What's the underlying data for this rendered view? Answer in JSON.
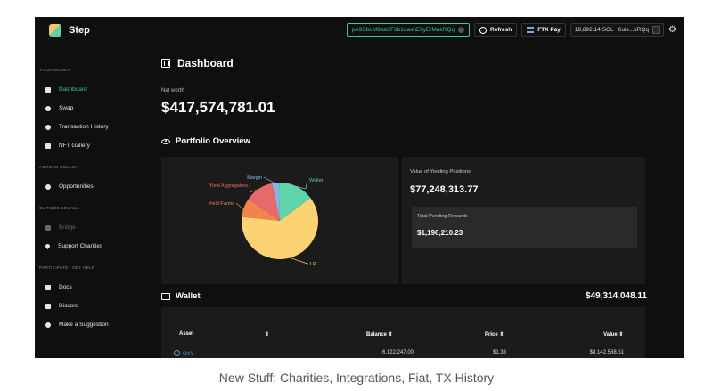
{
  "app": {
    "name": "Step"
  },
  "topbar": {
    "address": "pA9SbLM9saXFdb1dashEkyErMakRQq",
    "refresh_label": "Refresh",
    "ftx_label": "FTX Pay",
    "sol_balance": "19,892.14 SOL",
    "wallet_short": "Cuie...kRQq"
  },
  "sidebar": {
    "sections": [
      {
        "title": "YOUR MONEY",
        "items": [
          {
            "label": "Dashboard",
            "icon": "dashboard-icon",
            "active": true
          },
          {
            "label": "Swap",
            "icon": "swap-icon"
          },
          {
            "label": "Transaction History",
            "icon": "history-icon"
          },
          {
            "label": "NFT Gallery",
            "icon": "nft-icon"
          }
        ]
      },
      {
        "title": "ACROSS SOLANA",
        "items": [
          {
            "label": "Opportunities",
            "icon": "pie-icon"
          }
        ]
      },
      {
        "title": "OUTSIDE SOLANA",
        "items": [
          {
            "label": "Bridge",
            "icon": "bridge-icon",
            "disabled": true
          },
          {
            "label": "Support Charities",
            "icon": "heart-icon"
          }
        ]
      },
      {
        "title": "PARTICIPATE / GET HELP",
        "items": [
          {
            "label": "Docs",
            "icon": "docs-icon"
          },
          {
            "label": "Discord",
            "icon": "discord-icon"
          },
          {
            "label": "Make a Suggestion",
            "icon": "suggestion-icon"
          }
        ]
      }
    ]
  },
  "main": {
    "title": "Dashboard",
    "net_worth_label": "Net worth",
    "net_worth_value": "$417,574,781.01",
    "portfolio_title": "Portfolio Overview",
    "yield_label": "Value of Yielding Positions",
    "yield_value": "$77,248,313.77",
    "rewards_label": "Total Pending Rewards",
    "rewards_value": "$1,196,210.23",
    "wallet_title": "Wallet",
    "wallet_total": "$49,314,048.11",
    "table": {
      "headers": [
        "Asset",
        "Balance",
        "Price",
        "Value"
      ],
      "rows": [
        {
          "asset": "OXY",
          "balance": "6,122,247.00",
          "price": "$1.33",
          "value": "$8,142,588.51"
        }
      ]
    }
  },
  "chart_data": {
    "type": "pie",
    "labels": [
      "LP",
      "Yield Farms",
      "Yield Aggregators",
      "Margin",
      "Wallet"
    ],
    "values": [
      62,
      8,
      12,
      3,
      15
    ],
    "colors": [
      "#fcd373",
      "#f0844c",
      "#e8696a",
      "#8ab4e0",
      "#5fd4a9"
    ]
  },
  "caption": "New Stuff: Charities, Integrations, Fiat, TX History"
}
